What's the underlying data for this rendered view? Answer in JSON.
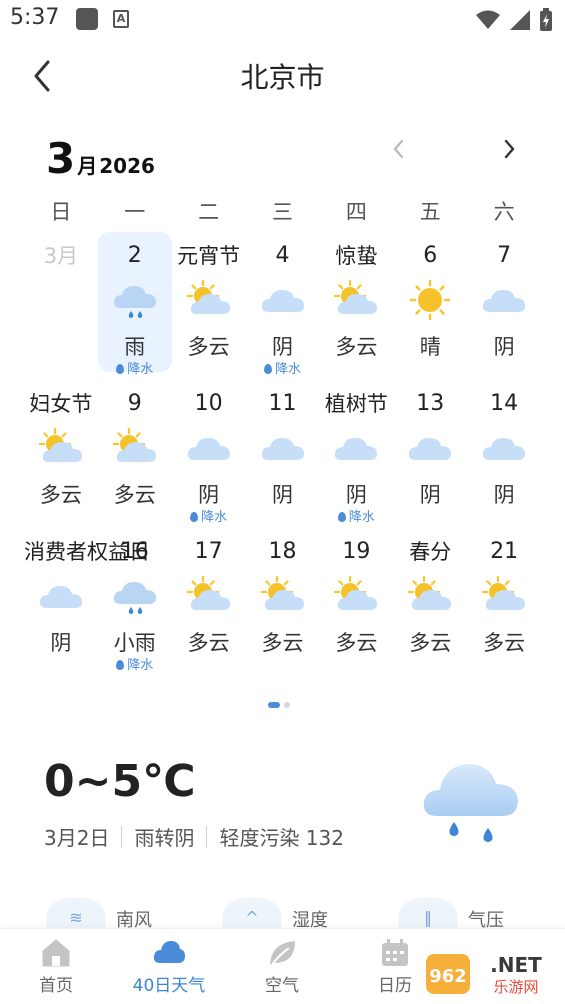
{
  "status": {
    "time": "5:37",
    "notif_letter": "A"
  },
  "header": {
    "title": "北京市"
  },
  "calendar": {
    "month": "3",
    "month_suffix": "月",
    "year": "2026",
    "weekdays": [
      "日",
      "一",
      "二",
      "三",
      "四",
      "五",
      "六"
    ],
    "rows": [
      [
        {
          "day": "3月",
          "dim": true
        },
        {
          "day": "2",
          "icon": "rain-cloud-icon",
          "weather": "雨",
          "precip": "降水",
          "selected": true
        },
        {
          "day": "元宵节",
          "icon": "partly-cloudy-icon",
          "weather": "多云"
        },
        {
          "day": "4",
          "icon": "cloud-icon",
          "weather": "阴",
          "precip": "降水"
        },
        {
          "day": "惊蛰",
          "icon": "partly-cloudy-icon",
          "weather": "多云"
        },
        {
          "day": "6",
          "icon": "sun-icon",
          "weather": "晴"
        },
        {
          "day": "7",
          "icon": "cloud-icon",
          "weather": "阴"
        }
      ],
      [
        {
          "day": "妇女节",
          "icon": "partly-cloudy-icon",
          "weather": "多云"
        },
        {
          "day": "9",
          "icon": "partly-cloudy-icon",
          "weather": "多云"
        },
        {
          "day": "10",
          "icon": "cloud-icon",
          "weather": "阴",
          "precip": "降水"
        },
        {
          "day": "11",
          "icon": "cloud-icon",
          "weather": "阴"
        },
        {
          "day": "植树节",
          "icon": "cloud-icon",
          "weather": "阴",
          "precip": "降水"
        },
        {
          "day": "13",
          "icon": "cloud-icon",
          "weather": "阴"
        },
        {
          "day": "14",
          "icon": "cloud-icon",
          "weather": "阴"
        }
      ],
      [
        {
          "day": "消费者权益日",
          "icon": "cloud-icon",
          "weather": "阴"
        },
        {
          "day": "16",
          "icon": "rain-cloud-icon",
          "weather": "小雨",
          "precip": "降水"
        },
        {
          "day": "17",
          "icon": "partly-cloudy-icon",
          "weather": "多云"
        },
        {
          "day": "18",
          "icon": "partly-cloudy-icon",
          "weather": "多云"
        },
        {
          "day": "19",
          "icon": "partly-cloudy-icon",
          "weather": "多云"
        },
        {
          "day": "春分",
          "icon": "partly-cloudy-icon",
          "weather": "多云"
        },
        {
          "day": "21",
          "icon": "partly-cloudy-icon",
          "weather": "多云"
        }
      ]
    ],
    "page": {
      "current": 1,
      "total": 2
    }
  },
  "detail": {
    "temp": "0~5℃",
    "date": "3月2日",
    "weather": "雨转阴",
    "air": "轻度污染 132",
    "icon": "rain-cloud-icon"
  },
  "metrics": [
    {
      "label": "南风",
      "icon": "wind-icon"
    },
    {
      "label": "湿度",
      "icon": "humidity-icon"
    },
    {
      "label": "气压",
      "icon": "pressure-icon"
    }
  ],
  "nav": [
    {
      "label": "首页",
      "icon": "home-icon"
    },
    {
      "label": "40日天气",
      "icon": "cloud-icon",
      "active": true
    },
    {
      "label": "空气",
      "icon": "leaf-icon"
    },
    {
      "label": "日历",
      "icon": "calendar-icon"
    }
  ],
  "watermark": {
    "text": "962.NET",
    "sub": "乐游网"
  },
  "colors": {
    "accent": "#3d86d6",
    "selected_bg": "#e9f2ff",
    "rain": "#4a8cd8",
    "sun": "#f7c62c",
    "cloud": "#bcd8f6"
  }
}
